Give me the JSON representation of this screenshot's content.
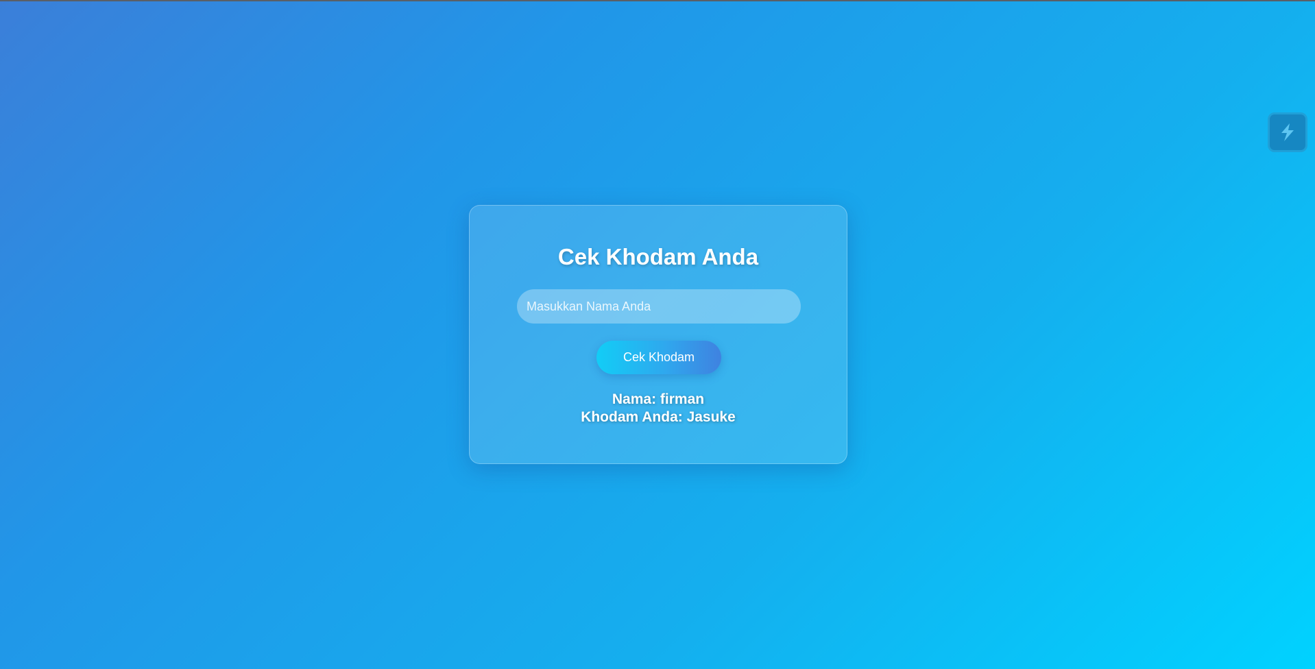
{
  "card": {
    "title": "Cek Khodam Anda",
    "input_placeholder": "Masukkan Nama Anda",
    "input_value": "",
    "button_label": "Cek Khodam",
    "result": {
      "name_line": "Nama: firman",
      "khodam_line": "Khodam Anda: Jasuke"
    }
  },
  "side_widget": {
    "icon": "lightning-bolt-icon"
  },
  "colors": {
    "background_start": "#3b7fd9",
    "background_end": "#00d2ff",
    "button_start": "#12cdf6",
    "button_end": "#3f82e0",
    "widget": "#1687c2"
  }
}
